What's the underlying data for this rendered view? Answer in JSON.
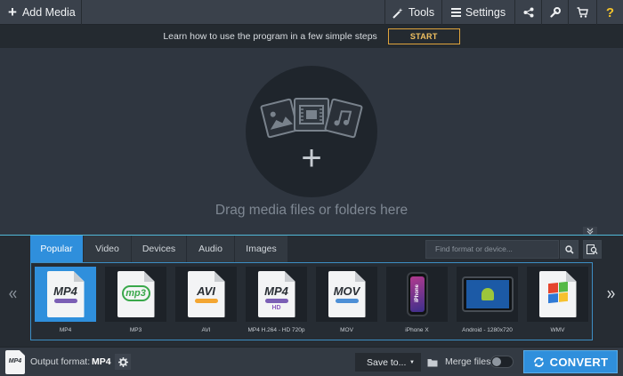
{
  "toolbar": {
    "add_media_label": "Add Media",
    "tools_label": "Tools",
    "settings_label": "Settings",
    "help_label": "?"
  },
  "tutorial": {
    "text": "Learn how to use the program in a few simple steps",
    "start_label": "START"
  },
  "dropzone": {
    "plus": "+",
    "text": "Drag media files or folders here"
  },
  "tabs": [
    {
      "label": "Popular",
      "active": true
    },
    {
      "label": "Video"
    },
    {
      "label": "Devices"
    },
    {
      "label": "Audio"
    },
    {
      "label": "Images"
    }
  ],
  "search": {
    "placeholder": "Find format or device..."
  },
  "formats": [
    {
      "label": "MP4",
      "icon_text": "MP4",
      "selected": true
    },
    {
      "label": "MP3",
      "icon_text": "mp3"
    },
    {
      "label": "AVI",
      "icon_text": "AVI"
    },
    {
      "label": "MP4 H.264 - HD 720p",
      "icon_text": "MP4",
      "badge": "HD"
    },
    {
      "label": "MOV",
      "icon_text": "MOV"
    },
    {
      "label": "iPhone X",
      "icon_text": "iPhone"
    },
    {
      "label": "Android - 1280x720"
    },
    {
      "label": "WMV"
    }
  ],
  "bottom": {
    "output_icon_text": "MP4",
    "output_label": "Output format:",
    "output_value": "MP4",
    "save_label": "Save to...",
    "merge_label": "Merge files:",
    "convert_label": "CONVERT"
  },
  "colors": {
    "accent": "#2f8fdc",
    "start_border": "#e0a43c",
    "help_icon": "#f5c32b"
  },
  "icons": [
    "plus-icon",
    "magic-wand-icon",
    "hamburger-icon",
    "share-icon",
    "wrench-icon",
    "cart-icon",
    "search-icon",
    "detect-device-icon",
    "chevron-left-icon",
    "chevron-right-icon",
    "gear-icon",
    "folder-icon",
    "refresh-icon"
  ]
}
